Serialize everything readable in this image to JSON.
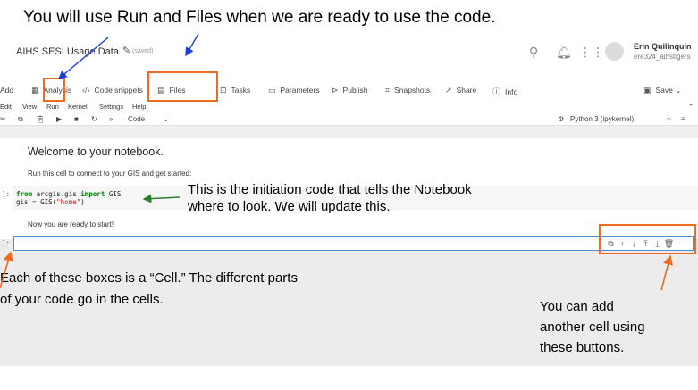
{
  "heading": "You will use Run and Files when we are ready to use the code.",
  "titlebar": {
    "notebook_title": "AIHS SESI Usage Data",
    "saved_label": "(saved)",
    "user_name": "Erin Quilinquin",
    "user_id": "ere324_aihstigers",
    "icons": [
      "search-icon",
      "bell-icon",
      "apps-grid-icon",
      "avatar"
    ]
  },
  "toolbar": {
    "items": [
      "Add",
      "Analysis",
      "Code snippets",
      "Files",
      "Tasks",
      "Parameters",
      "Publish",
      "Snapshots",
      "Share",
      "Info"
    ],
    "save_label": "Save"
  },
  "menubar": {
    "items": [
      "Edit",
      "View",
      "Run",
      "Kernel",
      "Settings",
      "Help"
    ]
  },
  "iconbar": {
    "cell_type": "Code",
    "kernel": "Python 3 (ipykernel)"
  },
  "notebook": {
    "welcome": "Welcome to your notebook.",
    "instruction": "Run this cell to connect to your GIS and get started:",
    "code_prompt": "]:",
    "code": {
      "line1_kw1": "from",
      "line1_mod": " arcgis.gis ",
      "line1_kw2": "import",
      "line1_rest": " GIS",
      "line2_pre": "gis = GIS(",
      "line2_str": "\"home\"",
      "line2_post": ")"
    },
    "ready": "Now you are ready to start!",
    "empty_prompt": "]:"
  },
  "annotations": {
    "initiation": "This is the initiation code that tells the Notebook where to look. We will update this.",
    "cell_line1": "Each of these boxes is a “Cell.” The different parts",
    "cell_line2": "of your code go in the cells.",
    "add_line1": "You can add",
    "add_line2": "another cell using",
    "add_line3": "these buttons."
  },
  "colors": {
    "highlight_box": "#ee6b21",
    "arrow_blue": "#1a3ed6",
    "arrow_green": "#2e7d2e",
    "active_cell_border": "#4a90d9"
  }
}
